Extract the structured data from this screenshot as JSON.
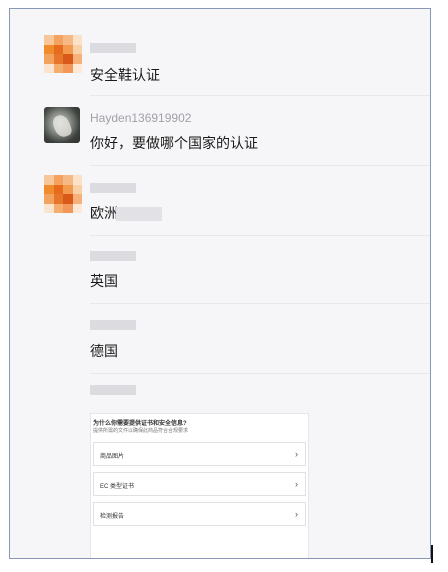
{
  "messages": [
    {
      "sender": "",
      "text": "安全鞋认证"
    },
    {
      "sender": "Hayden136919902",
      "text": "你好，要做哪个国家的认证"
    },
    {
      "sender": "",
      "text": "欧洲"
    },
    {
      "sender": "",
      "text": "英国"
    },
    {
      "sender": "",
      "text": "德国"
    }
  ],
  "card": {
    "title": "为什么你需要提供证书和安全信息?",
    "subtitle": "提供所需的文件以确保此商品符合合规要求",
    "rows": [
      {
        "label": "商品图片",
        "chevron": "›"
      },
      {
        "label": "EC 类型证书",
        "chevron": "›"
      },
      {
        "label": "检测报告",
        "chevron": "›"
      }
    ]
  },
  "colors": {
    "accent_orange": "#f08c2c",
    "frame_border": "#8a98b8"
  }
}
